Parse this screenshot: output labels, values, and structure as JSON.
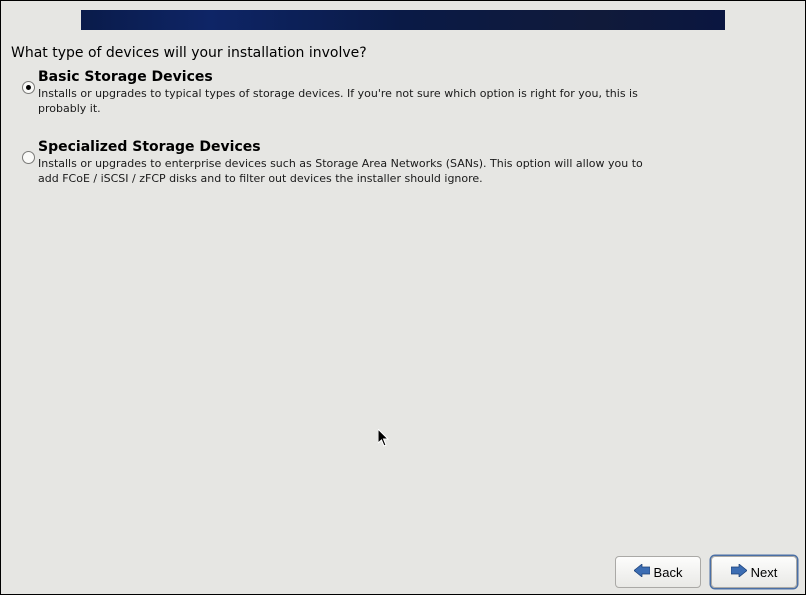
{
  "question": "What type of devices will your installation involve?",
  "options": [
    {
      "title": "Basic Storage Devices",
      "desc": "Installs or upgrades to typical types of storage devices.  If you're not sure which option is right for you, this is probably it.",
      "selected": true
    },
    {
      "title": "Specialized Storage Devices",
      "desc": "Installs or upgrades to enterprise devices such as Storage Area Networks (SANs). This option will allow you to add FCoE / iSCSI / zFCP disks and to filter out devices the installer should ignore.",
      "selected": false
    }
  ],
  "buttons": {
    "back": "Back",
    "next": "Next"
  }
}
